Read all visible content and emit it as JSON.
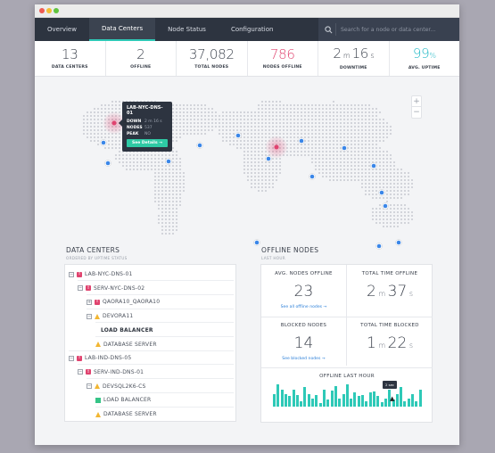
{
  "nav": {
    "tabs": [
      {
        "label": "Overview",
        "active": false
      },
      {
        "label": "Data Centers",
        "active": true
      },
      {
        "label": "Node Status",
        "active": false
      },
      {
        "label": "Configuration",
        "active": false
      }
    ],
    "search_placeholder": "Search for a node or data center..."
  },
  "stats": [
    {
      "value": "13",
      "label": "DATA CENTERS",
      "color": "#3f4550"
    },
    {
      "value": "2",
      "label": "OFFLINE",
      "color": "#3f4550"
    },
    {
      "value": "37,082",
      "label": "TOTAL NODES",
      "color": "#3f4550"
    },
    {
      "value": "786",
      "label": "NODES OFFLINE",
      "color": "#e0436f"
    },
    {
      "value_main": "2",
      "unit1": "m",
      "value_sec": "16",
      "unit2": "s",
      "label": "DOWNTIME"
    },
    {
      "value": "99",
      "unit": "%",
      "label": "AVG. UPTIME",
      "color": "#21b8c6"
    }
  ],
  "map": {
    "zoom_in": "+",
    "zoom_out": "−",
    "tooltip": {
      "title": "LAB-NYC-DNS-01",
      "down_label": "DOWN",
      "down_value": "2 m 16 s",
      "nodes_label": "NODES",
      "nodes_value": "537",
      "peak_label": "PEAK",
      "peak_value": "NO",
      "button": "See Details →"
    }
  },
  "data_centers": {
    "title": "DATA CENTERS",
    "subtitle": "ORDERED BY UPTIME STATUS",
    "tree": [
      {
        "label": "LAB-NYC-DNS-01",
        "depth": 0,
        "toggle": "−",
        "status": "error"
      },
      {
        "label": "SERV-NYC-DNS-02",
        "depth": 1,
        "toggle": "−",
        "status": "error"
      },
      {
        "label": "QAORA10_QAORA10",
        "depth": 2,
        "toggle": "+",
        "status": "error"
      },
      {
        "label": "DEVORA11",
        "depth": 2,
        "toggle": "−",
        "status": "warning"
      },
      {
        "label": "LOAD BALANCER",
        "depth": 3,
        "toggle": "",
        "status": "none"
      },
      {
        "label": "DATABASE SERVER",
        "depth": 3,
        "toggle": "",
        "status": "warning"
      },
      {
        "label": "LAB-IND-DNS-05",
        "depth": 0,
        "toggle": "−",
        "status": "error"
      },
      {
        "label": "SERV-IND-DNS-01",
        "depth": 1,
        "toggle": "−",
        "status": "error"
      },
      {
        "label": "DEVSQL2K6-CS",
        "depth": 2,
        "toggle": "−",
        "status": "warning"
      },
      {
        "label": "LOAD BALANCER",
        "depth": 3,
        "toggle": "",
        "status": "ok"
      },
      {
        "label": "DATABASE SERVER",
        "depth": 3,
        "toggle": "",
        "status": "warning"
      }
    ]
  },
  "offline_nodes": {
    "title": "OFFLINE NODES",
    "subtitle": "LAST HOUR",
    "avg_title": "AVG. NODES OFFLINE",
    "avg_value": "23",
    "avg_link": "See all offline nodes  →",
    "total_offline_title": "TOTAL TIME OFFLINE",
    "total_offline_m": "2",
    "total_offline_s": "37",
    "blocked_title": "BLOCKED NODES",
    "blocked_value": "14",
    "blocked_link": "See blocked nodes  →",
    "total_blocked_title": "TOTAL TIME BLOCKED",
    "total_blocked_m": "1",
    "total_blocked_s": "22",
    "unit_m": "m",
    "unit_s": "s",
    "chart_title": "OFFLINE LAST HOUR",
    "chart_tooltip": "2 sec",
    "bar_values": [
      0.55,
      0.95,
      0.75,
      0.55,
      0.45,
      0.75,
      0.5,
      0.25,
      0.85,
      0.55,
      0.35,
      0.5,
      0.15,
      0.75,
      0.3,
      0.7,
      0.9,
      0.35,
      0.55,
      0.95,
      0.35,
      0.6,
      0.45,
      0.5,
      0.25,
      0.6,
      0.65,
      0.45,
      0.2,
      0.35,
      0.75,
      0.3,
      0.55,
      0.85,
      0.25,
      0.35,
      0.55,
      0.25,
      0.75
    ],
    "bar_color": "#2ec9b7"
  }
}
